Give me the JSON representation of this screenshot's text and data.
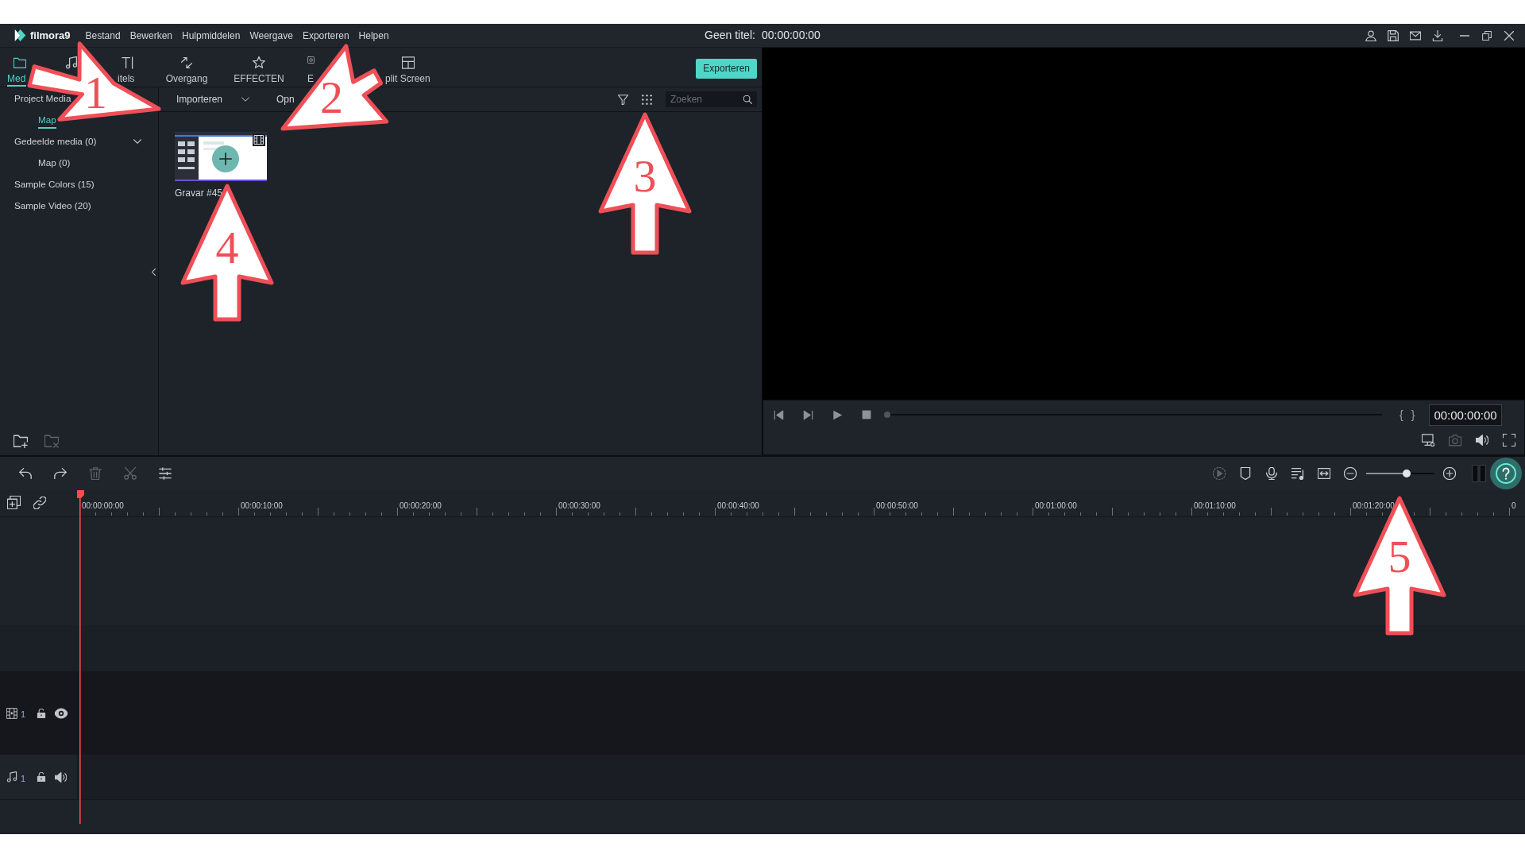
{
  "window": {
    "app_name": "filmora9",
    "menu": [
      "Bestand",
      "Bewerken",
      "Hulpmiddelen",
      "Weergave",
      "Exporteren",
      "Helpen"
    ],
    "title": "Geen titel:",
    "duration": "00:00:00:00"
  },
  "tabs": [
    {
      "label": "Med",
      "selected": true
    },
    {
      "selected": false
    },
    {
      "label": "itels",
      "selected": false
    },
    {
      "label": "Overgang",
      "selected": false
    },
    {
      "label": "EFFECTEN",
      "selected": false
    },
    {
      "label": "E",
      "selected": false
    },
    {
      "label": "plit Screen",
      "selected": false
    }
  ],
  "export_button": "Exporteren",
  "sidebar": {
    "items": [
      {
        "label": "Project Media",
        "selected": false,
        "children": [
          {
            "label": "Map",
            "selected": true
          }
        ]
      },
      {
        "label": "Gedeelde media (0)",
        "selected": false,
        "expanded": true,
        "children": [
          {
            "label": "Map (0)",
            "selected": false
          }
        ]
      },
      {
        "label": "Sample Colors (15)",
        "selected": false
      },
      {
        "label": "Sample Video (20)",
        "selected": false
      }
    ],
    "folder_actions": [
      {
        "disabled": false
      },
      {
        "disabled": true
      }
    ]
  },
  "media_toolbar": {
    "import_dropdown": "Importeren",
    "button_2": "Opn",
    "search": {
      "placeholder": "Zoeken"
    }
  },
  "media_items": [
    {
      "label": "Gravar #45"
    }
  ],
  "preview": {
    "seek": {
      "level": 0
    },
    "mark_in": "{",
    "mark_out": "}",
    "timecode": "00:00:00:00",
    "tools": [
      {
        "disabled": false
      },
      {
        "disabled": true
      },
      {
        "disabled": false
      },
      {
        "disabled": false
      }
    ]
  },
  "timeline": {
    "tools_left": [
      {
        "disabled": false
      },
      {
        "disabled": false
      },
      {
        "disabled": true
      },
      {
        "disabled": true
      },
      {
        "disabled": false
      }
    ],
    "tools_right": [
      {
        "disabled": true
      },
      {
        "disabled": false
      },
      {
        "disabled": false
      },
      {
        "disabled": false
      },
      {
        "disabled": false
      }
    ],
    "zoom": {
      "level": 0.6
    },
    "ruler": [
      "00:00:00:00",
      "00:00:10:00",
      "00:00:20:00",
      "00:00:30:00",
      "00:00:40:00",
      "00:00:50:00",
      "00:01:00:00",
      "00:01:10:00",
      "00:01:20:00",
      "0"
    ],
    "tracks": [
      {
        "kind": "video",
        "number": "1",
        "locked": false,
        "visible": true
      },
      {
        "kind": "audio",
        "number": "1",
        "locked": false,
        "muted": false
      }
    ]
  },
  "annotations": [
    {
      "label": "1"
    },
    {
      "label": "2"
    },
    {
      "label": "3"
    },
    {
      "label": "4"
    },
    {
      "label": "5"
    }
  ]
}
